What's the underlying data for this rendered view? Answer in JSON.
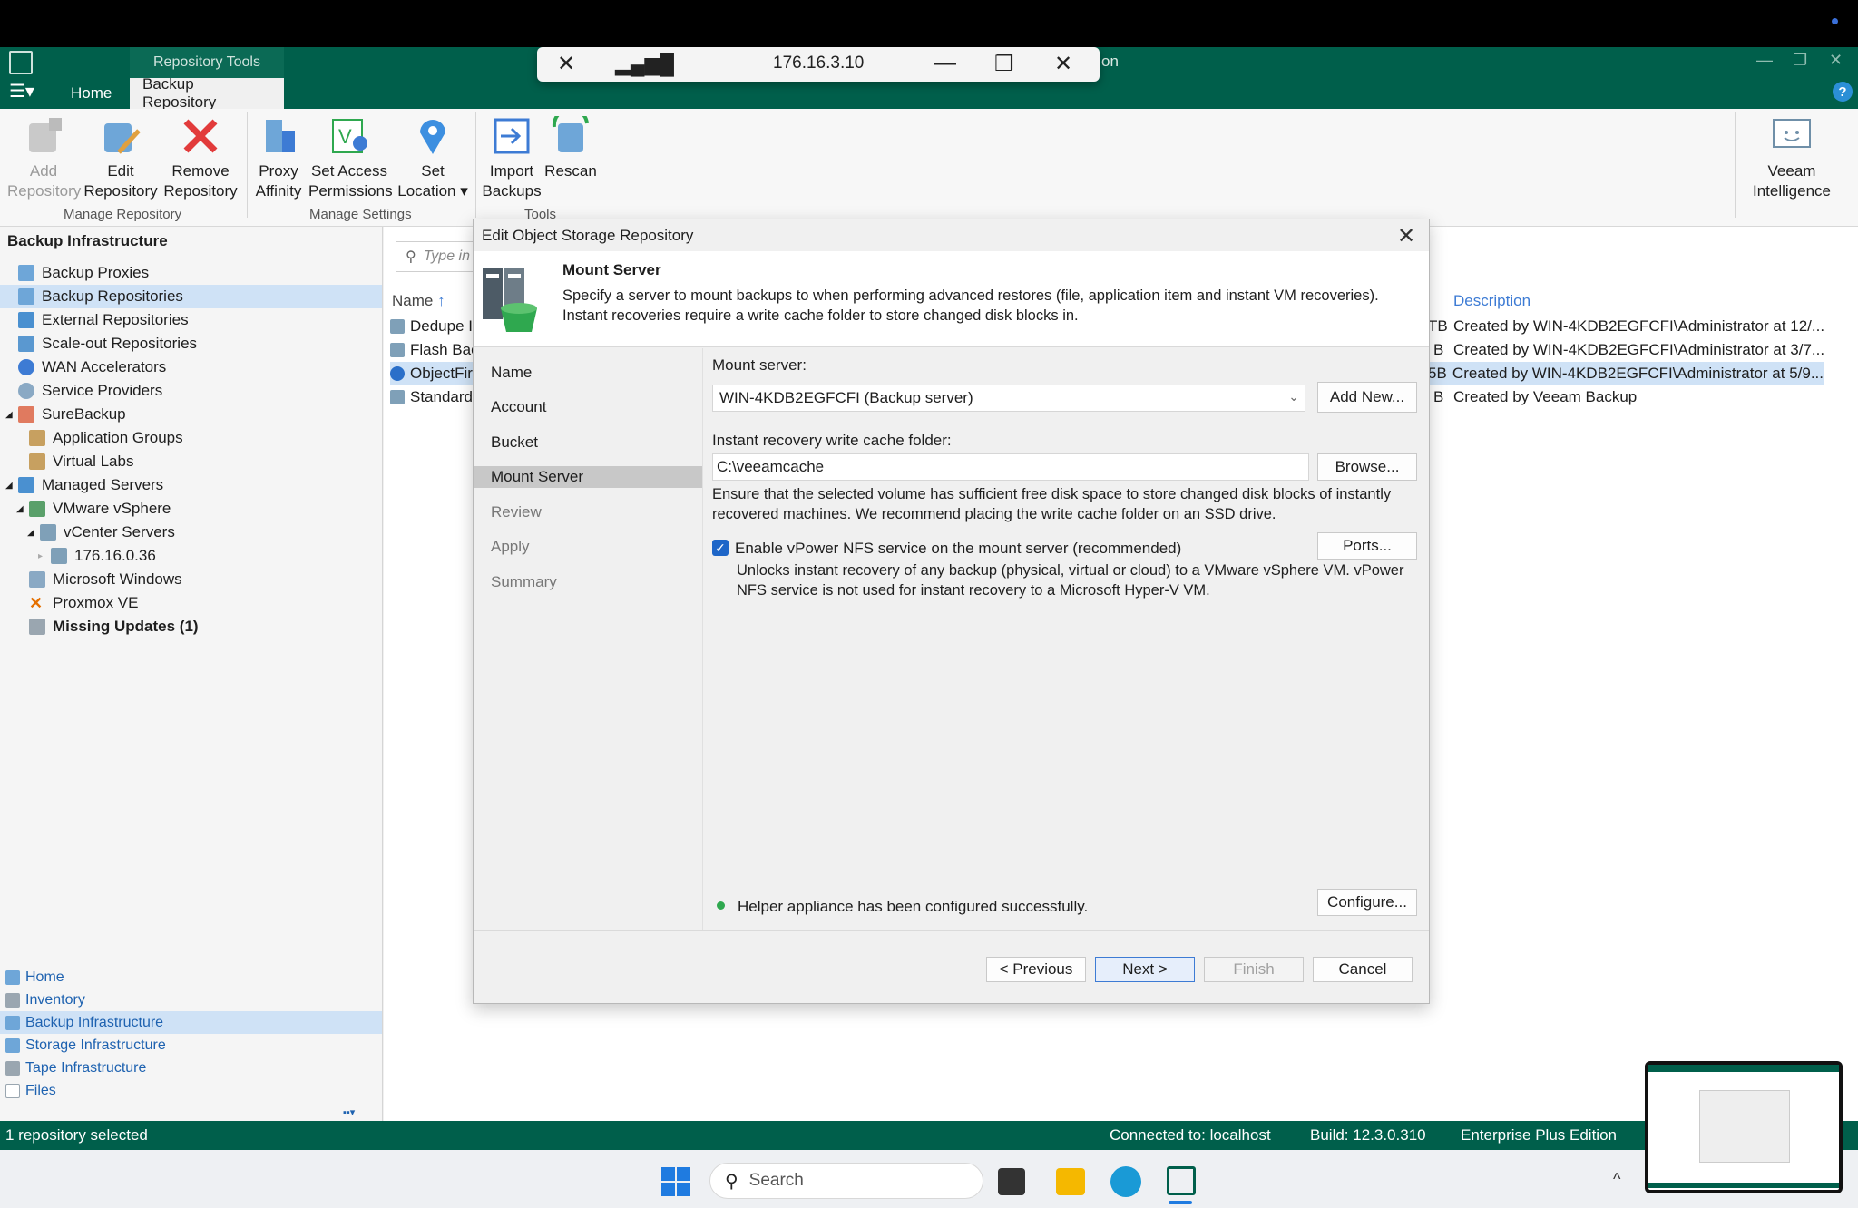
{
  "rdp_bar": {
    "host": "176.16.3.10"
  },
  "app": {
    "title_suffix": "on",
    "context_tab": "Repository Tools",
    "tabs": [
      "Home",
      "Backup Repository"
    ],
    "help": "?"
  },
  "ribbon": {
    "buttons": [
      {
        "label1": "Add",
        "label2": "Repository",
        "enabled": false
      },
      {
        "label1": "Edit",
        "label2": "Repository",
        "enabled": true
      },
      {
        "label1": "Remove",
        "label2": "Repository",
        "enabled": true
      },
      {
        "label1": "Proxy",
        "label2": "Affinity",
        "enabled": true
      },
      {
        "label1": "Set Access",
        "label2": "Permissions",
        "enabled": true
      },
      {
        "label1": "Set",
        "label2": "Location ▾",
        "enabled": true
      },
      {
        "label1": "Import",
        "label2": "Backups",
        "enabled": true
      },
      {
        "label1": "Rescan",
        "label2": "",
        "enabled": true
      },
      {
        "label1": "Veeam",
        "label2": "Intelligence",
        "enabled": true
      }
    ],
    "groups": [
      "Manage Repository",
      "Manage Settings",
      "Tools"
    ]
  },
  "sidebar": {
    "title": "Backup Infrastructure",
    "items": [
      {
        "label": "Backup Proxies",
        "icon": "proxy-icon"
      },
      {
        "label": "Backup Repositories",
        "icon": "repository-icon"
      },
      {
        "label": "External Repositories",
        "icon": "external-repo-icon"
      },
      {
        "label": "Scale-out Repositories",
        "icon": "scaleout-icon"
      },
      {
        "label": "WAN Accelerators",
        "icon": "wan-icon"
      },
      {
        "label": "Service Providers",
        "icon": "provider-icon"
      },
      {
        "label": "SureBackup",
        "icon": "surebackup-icon"
      },
      {
        "label": "Application Groups",
        "icon": "app-group-icon"
      },
      {
        "label": "Virtual Labs",
        "icon": "virtual-lab-icon"
      },
      {
        "label": "Managed Servers",
        "icon": "servers-icon"
      },
      {
        "label": "VMware vSphere",
        "icon": "vsphere-icon"
      },
      {
        "label": "vCenter Servers",
        "icon": "vcenter-icon"
      },
      {
        "label": "176.16.0.36",
        "icon": "vcenter-host-icon"
      },
      {
        "label": "Microsoft Windows",
        "icon": "windows-icon"
      },
      {
        "label": "Proxmox VE",
        "icon": "proxmox-icon"
      },
      {
        "label": "Missing Updates (1)",
        "icon": "updates-icon"
      }
    ],
    "nav": [
      "Home",
      "Inventory",
      "Backup Infrastructure",
      "Storage Infrastructure",
      "Tape Infrastructure",
      "Files"
    ]
  },
  "list": {
    "search_placeholder": "Type in",
    "col_name": "Name",
    "col_desc": "Description",
    "rows": [
      {
        "name": "Dedupe I",
        "size_frag": "TB",
        "desc": "Created by WIN-4KDB2EGFCFI\\Administrator at 12/..."
      },
      {
        "name": "Flash Bac",
        "size_frag": "B",
        "desc": "Created by WIN-4KDB2EGFCFI\\Administrator at 3/7..."
      },
      {
        "name": "ObjectFir",
        "size_frag": "5B",
        "desc": "Created by WIN-4KDB2EGFCFI\\Administrator at 5/9..."
      },
      {
        "name": "Standard",
        "size_frag": "B",
        "desc": "Created by Veeam Backup"
      }
    ]
  },
  "dialog": {
    "title": "Edit Object Storage Repository",
    "header_title": "Mount Server",
    "header_desc": "Specify a server to mount backups to when performing advanced restores (file, application item and instant VM recoveries). Instant recoveries require a write cache folder to store changed disk blocks in.",
    "steps": [
      "Name",
      "Account",
      "Bucket",
      "Mount Server",
      "Review",
      "Apply",
      "Summary"
    ],
    "mount_server_label": "Mount server:",
    "mount_server_value": "WIN-4KDB2EGFCFI (Backup server)",
    "add_new": "Add New...",
    "cache_label": "Instant recovery write cache folder:",
    "cache_value": "C:\\veeamcache",
    "browse": "Browse...",
    "cache_note": "Ensure that the selected volume has sufficient free disk space to store changed disk blocks of instantly recovered machines. We recommend placing the write cache folder on an SSD drive.",
    "nfs_label": "Enable vPower NFS service on the mount server (recommended)",
    "nfs_checked": true,
    "ports": "Ports...",
    "nfs_note": "Unlocks instant recovery of any backup (physical, virtual or cloud) to a VMware vSphere VM.  vPower NFS service is not used for instant recovery to a Microsoft Hyper-V VM.",
    "helper_status": "Helper appliance has been configured successfully.",
    "configure": "Configure...",
    "previous": "< Previous",
    "next": "Next >",
    "finish": "Finish",
    "cancel": "Cancel"
  },
  "status": {
    "left": "1 repository selected",
    "connected": "Connected to: localhost",
    "build": "Build: 12.3.0.310",
    "edition": "Enterprise Plus Edition"
  },
  "taskbar": {
    "search_placeholder": "Search"
  }
}
